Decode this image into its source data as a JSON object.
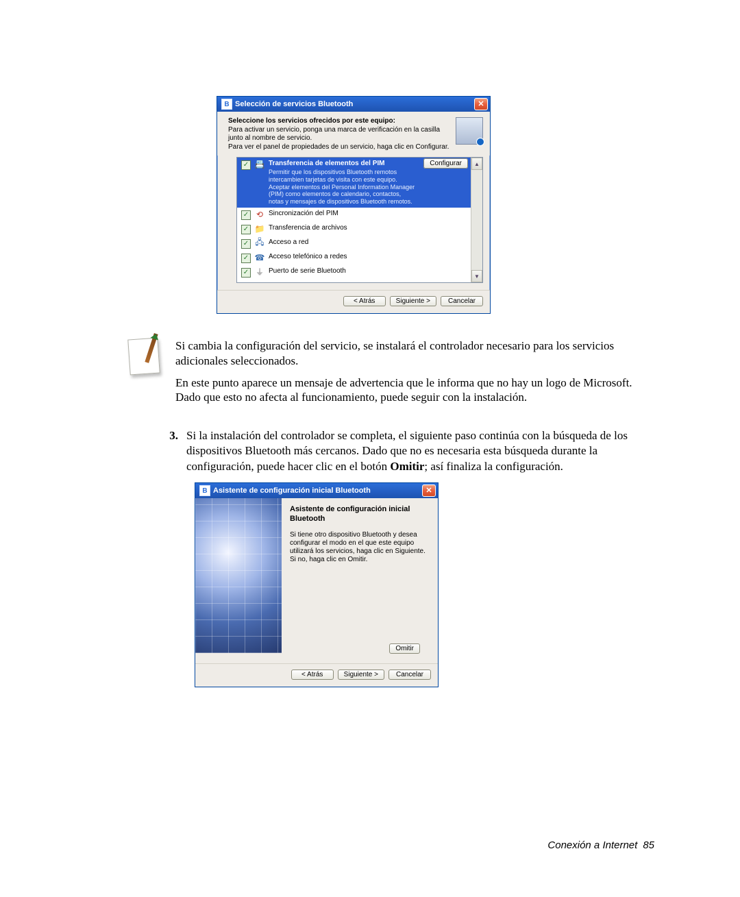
{
  "dlg1": {
    "title": "Selección de servicios Bluetooth",
    "instr_bold": "Seleccione los servicios ofrecidos por este equipo:",
    "instr_line1": "Para activar un servicio, ponga una marca de verificación en la casilla junto al nombre de servicio.",
    "instr_line2": "Para ver el panel de propiedades de un servicio, haga clic en Configurar.",
    "selected": {
      "title": "Transferencia de elementos del PIM",
      "desc": "Permitir que los dispositivos Bluetooth remotos intercambien tarjetas de visita con este equipo. Aceptar elementos del Personal Information Manager (PIM) como elementos de calendario, contactos, notas y mensajes de dispositivos Bluetooth remotos.",
      "configure": "Configurar"
    },
    "items": [
      "Sincronización del PIM",
      "Transferencia de archivos",
      "Acceso a red",
      "Acceso telefónico a redes",
      "Puerto de serie Bluetooth"
    ],
    "btn_back": "< Atrás",
    "btn_next": "Siguiente >",
    "btn_cancel": "Cancelar"
  },
  "note": {
    "p1": "Si cambia la configuración del servicio, se instalará el controlador necesario para los servicios adicionales seleccionados.",
    "p2": "En este punto aparece un mensaje de advertencia que le informa que no hay un logo de Microsoft. Dado que esto no afecta al funcionamiento, puede seguir con la instalación."
  },
  "step3": {
    "num": "3.",
    "pre": "Si la instalación del controlador se completa, el siguiente paso continúa con la búsqueda de los dispositivos Bluetooth más cercanos. Dado que no es necesaria esta búsqueda durante la configuración, puede hacer clic en el botón ",
    "bold": "Omitir",
    "post": "; así finaliza la configuración."
  },
  "dlg2": {
    "title": "Asistente de configuración inicial Bluetooth",
    "heading": "Asistente de configuración inicial Bluetooth",
    "para": "Si tiene otro dispositivo Bluetooth y desea configurar el modo en el que este equipo utilizará los servicios, haga clic en Siguiente. Si no, haga clic en Omitir.",
    "btn_skip": "Omitir",
    "btn_back": "< Atrás",
    "btn_next": "Siguiente >",
    "btn_cancel": "Cancelar"
  },
  "footer": {
    "section": "Conexión a Internet",
    "page": "85"
  }
}
